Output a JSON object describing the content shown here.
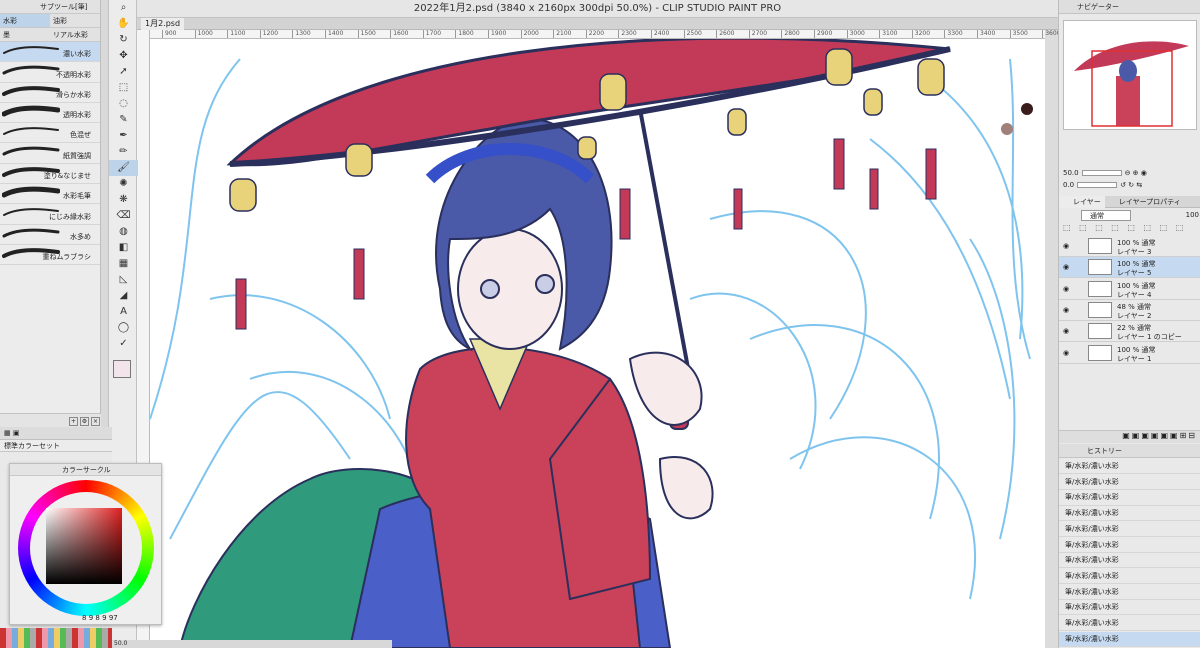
{
  "window": {
    "title": "2022年1月2.psd (3840 x 2160px 300dpi 50.0%)  - CLIP STUDIO PAINT PRO",
    "doc_tab": "1月2.psd"
  },
  "ruler": {
    "ticks": [
      "900",
      "1000",
      "1100",
      "1200",
      "1300",
      "1400",
      "1500",
      "1600",
      "1700",
      "1800",
      "1900",
      "2000",
      "2100",
      "2200",
      "2300",
      "2400",
      "2500",
      "2600",
      "2700",
      "2800",
      "2900",
      "3000",
      "3100",
      "3200",
      "3300",
      "3400",
      "3500",
      "3600"
    ]
  },
  "subtool": {
    "title": "サブツール[筆]",
    "tabs": [
      "水彩",
      "油彩",
      "墨",
      "リアル水彩"
    ],
    "brushes": [
      "濃い水彩",
      "不透明水彩",
      "滑らか水彩",
      "透明水彩",
      "色混ぜ",
      "紙質強調",
      "塗り&なじませ",
      "水彩毛筆",
      "にじみ縁水彩",
      "水多め",
      "重ねムラブラシ"
    ],
    "selected_index": 0
  },
  "tools": [
    "zoom",
    "hand",
    "rotate",
    "move",
    "operation",
    "select",
    "lasso",
    "eyedropper",
    "pen",
    "pencil",
    "brush",
    "airbrush",
    "decoration",
    "eraser",
    "blend",
    "fill",
    "gradient",
    "figure",
    "ruler",
    "text",
    "balloon",
    "correction"
  ],
  "colorset": {
    "title": "標準カラーセット"
  },
  "colorwheel": {
    "title": "カラーサークル",
    "values": [
      "8",
      "9",
      "8",
      "9",
      "97"
    ]
  },
  "navigator": {
    "title": "ナビゲーター",
    "zoom": "50.0",
    "angle": "0.0"
  },
  "layers": {
    "tabs": [
      "レイヤー",
      "レイヤープロパティ"
    ],
    "blend": "通常",
    "opacity": "100",
    "items": [
      {
        "mode": "100 % 通常",
        "name": "レイヤー 3",
        "selected": false
      },
      {
        "mode": "100 % 通常",
        "name": "レイヤー 5",
        "selected": true
      },
      {
        "mode": "100 % 通常",
        "name": "レイヤー 4",
        "selected": false
      },
      {
        "mode": "48 % 通常",
        "name": "レイヤー 2",
        "selected": false
      },
      {
        "mode": "22 % 通常",
        "name": "レイヤー 1 のコピー",
        "selected": false
      },
      {
        "mode": "100 % 通常",
        "name": "レイヤー 1",
        "selected": false
      }
    ]
  },
  "history": {
    "title": "ヒストリー",
    "items": [
      "筆/水彩/濃い水彩",
      "筆/水彩/濃い水彩",
      "筆/水彩/濃い水彩",
      "筆/水彩/濃い水彩",
      "筆/水彩/濃い水彩",
      "筆/水彩/濃い水彩",
      "筆/水彩/濃い水彩",
      "筆/水彩/濃い水彩",
      "筆/水彩/濃い水彩",
      "筆/水彩/濃い水彩",
      "筆/水彩/濃い水彩",
      "筆/水彩/濃い水彩"
    ],
    "selected_index": 11
  },
  "status": {
    "zoom": "50.0"
  },
  "colors": {
    "accent": "#c5daf0",
    "umbrella": "#c23a58",
    "kimono": "#c9425a",
    "sketch": "#7fc4ee",
    "hair": "#4a5aa8"
  }
}
